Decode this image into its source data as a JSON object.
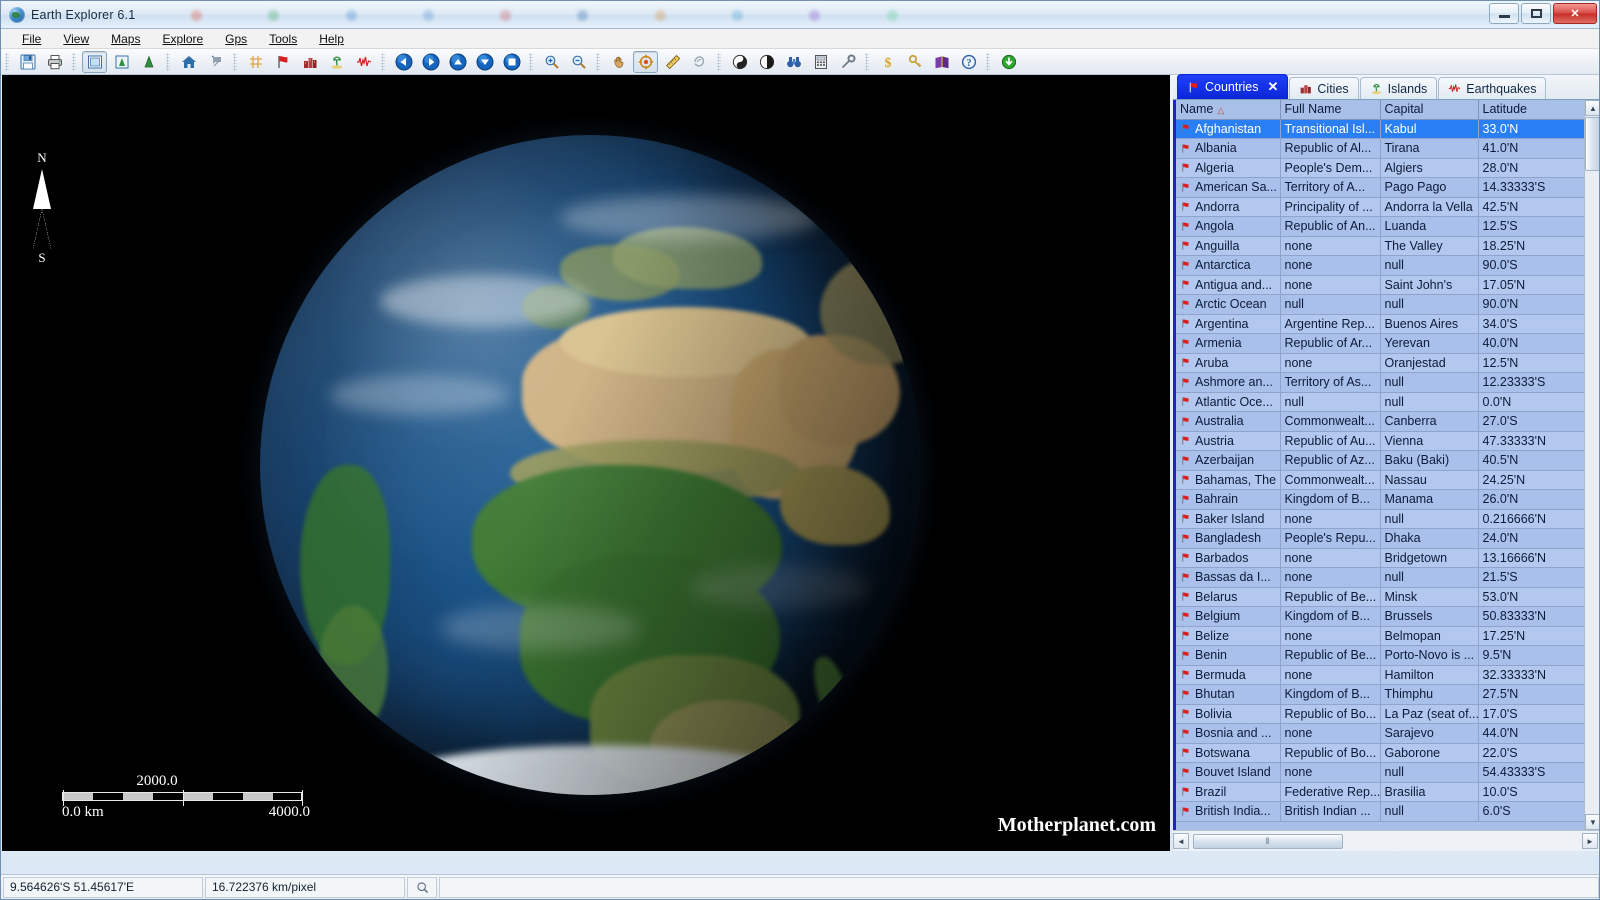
{
  "window": {
    "title": "Earth Explorer 6.1",
    "app_icon": "globe-icon",
    "minimize_label": "–",
    "maximize_label": "❑",
    "close_label": "✕"
  },
  "menu": {
    "items": [
      {
        "label": "File",
        "mnemonic": "F"
      },
      {
        "label": "View",
        "mnemonic": "V"
      },
      {
        "label": "Maps",
        "mnemonic": "M"
      },
      {
        "label": "Explore",
        "mnemonic": "E"
      },
      {
        "label": "Gps",
        "mnemonic": "G"
      },
      {
        "label": "Tools",
        "mnemonic": "T"
      },
      {
        "label": "Help",
        "mnemonic": "H"
      }
    ]
  },
  "toolbar": {
    "groups": [
      {
        "buttons": [
          {
            "name": "save-button",
            "icon": "floppy-disk-icon",
            "pressed": false
          },
          {
            "name": "print-button",
            "icon": "printer-icon",
            "pressed": false
          }
        ]
      },
      {
        "buttons": [
          {
            "name": "flat-map-button",
            "icon": "square-map-icon",
            "pressed": true
          },
          {
            "name": "globe-small-button",
            "icon": "globe-box-icon",
            "pressed": false
          },
          {
            "name": "globe-button",
            "icon": "globe-cone-icon",
            "pressed": false
          }
        ]
      },
      {
        "buttons": [
          {
            "name": "home-button",
            "icon": "home-icon",
            "pressed": false
          },
          {
            "name": "add-location-button",
            "icon": "add-pin-icon",
            "pressed": false
          }
        ]
      },
      {
        "buttons": [
          {
            "name": "grid-button",
            "icon": "grid-icon",
            "pressed": false
          },
          {
            "name": "countries-button",
            "icon": "red-flag-icon",
            "pressed": false
          },
          {
            "name": "cities-button",
            "icon": "city-icon",
            "pressed": false
          },
          {
            "name": "islands-button",
            "icon": "island-icon",
            "pressed": false
          },
          {
            "name": "earthquakes-button",
            "icon": "seismograph-icon",
            "pressed": false
          }
        ]
      },
      {
        "buttons": [
          {
            "name": "pan-left-button",
            "icon": "arrow-left-icon",
            "pressed": false
          },
          {
            "name": "pan-right-button",
            "icon": "arrow-right-icon",
            "pressed": false
          },
          {
            "name": "pan-up-button",
            "icon": "arrow-up-icon",
            "pressed": false
          },
          {
            "name": "pan-down-button",
            "icon": "arrow-down-icon",
            "pressed": false
          },
          {
            "name": "stop-button",
            "icon": "stop-square-icon",
            "pressed": false
          }
        ]
      },
      {
        "buttons": [
          {
            "name": "zoom-in-button",
            "icon": "magnifier-plus-icon",
            "pressed": false
          },
          {
            "name": "zoom-out-button",
            "icon": "magnifier-minus-icon",
            "pressed": false
          }
        ]
      },
      {
        "buttons": [
          {
            "name": "hand-tool-button",
            "icon": "hand-icon",
            "pressed": false
          },
          {
            "name": "target-tool-button",
            "icon": "crosshair-target-icon",
            "pressed": true
          },
          {
            "name": "measure-tool-button",
            "icon": "ruler-icon",
            "pressed": false
          },
          {
            "name": "area-tool-button",
            "icon": "polygon-icon",
            "pressed": false
          }
        ]
      },
      {
        "buttons": [
          {
            "name": "day-night-button",
            "icon": "yin-yang-icon",
            "pressed": false
          },
          {
            "name": "terminator-button",
            "icon": "half-moon-icon",
            "pressed": false
          },
          {
            "name": "find-button",
            "icon": "binoculars-icon",
            "pressed": false
          },
          {
            "name": "calculator-button",
            "icon": "calculator-icon",
            "pressed": false
          },
          {
            "name": "options-button",
            "icon": "tools-icon",
            "pressed": false
          }
        ]
      },
      {
        "buttons": [
          {
            "name": "currency-button",
            "icon": "dollar-icon",
            "pressed": false
          },
          {
            "name": "keys-button",
            "icon": "key-icon",
            "pressed": false
          },
          {
            "name": "atlas-book-button",
            "icon": "book-icon",
            "pressed": false
          },
          {
            "name": "help-button",
            "icon": "question-mark-icon",
            "pressed": false
          }
        ]
      },
      {
        "buttons": [
          {
            "name": "download-button",
            "icon": "green-download-icon",
            "pressed": false
          }
        ]
      }
    ]
  },
  "viewport": {
    "compass": {
      "north_label": "N",
      "south_label": "S"
    },
    "scalebar": {
      "mid_label": "2000.0",
      "start_label": "0.0 km",
      "end_label": "4000.0"
    },
    "watermark": "Motherplanet.com"
  },
  "panel": {
    "tabs": [
      {
        "label": "Countries",
        "icon": "red-flag-icon",
        "active": true,
        "closable": true,
        "close_label": "✕"
      },
      {
        "label": "Cities",
        "icon": "city-icon",
        "active": false,
        "closable": false
      },
      {
        "label": "Islands",
        "icon": "island-icon",
        "active": false,
        "closable": false
      },
      {
        "label": "Earthquakes",
        "icon": "seismograph-icon",
        "active": false,
        "closable": false
      }
    ],
    "columns": [
      {
        "label": "Name",
        "sorted": true,
        "sort_mark": "△"
      },
      {
        "label": "Full Name",
        "sorted": false
      },
      {
        "label": "Capital",
        "sorted": false
      },
      {
        "label": "Latitude",
        "sorted": false
      }
    ],
    "rows": [
      {
        "name": "Afghanistan",
        "full": "Transitional Isl...",
        "capital": "Kabul",
        "lat": "33.0'N",
        "selected": true
      },
      {
        "name": "Albania",
        "full": "Republic of Al...",
        "capital": "Tirana",
        "lat": "41.0'N",
        "selected": false
      },
      {
        "name": "Algeria",
        "full": "People's Dem...",
        "capital": "Algiers",
        "lat": "28.0'N",
        "selected": false
      },
      {
        "name": "American Sa...",
        "full": "Territory of A...",
        "capital": "Pago Pago",
        "lat": "14.33333'S",
        "selected": false
      },
      {
        "name": "Andorra",
        "full": "Principality of ...",
        "capital": "Andorra la Vella",
        "lat": "42.5'N",
        "selected": false
      },
      {
        "name": "Angola",
        "full": "Republic of An...",
        "capital": "Luanda",
        "lat": "12.5'S",
        "selected": false
      },
      {
        "name": "Anguilla",
        "full": "none",
        "capital": "The Valley",
        "lat": "18.25'N",
        "selected": false
      },
      {
        "name": "Antarctica",
        "full": "none",
        "capital": "null",
        "lat": "90.0'S",
        "selected": false
      },
      {
        "name": "Antigua and...",
        "full": "none",
        "capital": "Saint John's",
        "lat": "17.05'N",
        "selected": false
      },
      {
        "name": "Arctic Ocean",
        "full": "null",
        "capital": "null",
        "lat": "90.0'N",
        "selected": false
      },
      {
        "name": "Argentina",
        "full": "Argentine Rep...",
        "capital": "Buenos Aires",
        "lat": "34.0'S",
        "selected": false
      },
      {
        "name": "Armenia",
        "full": "Republic of Ar...",
        "capital": "Yerevan",
        "lat": "40.0'N",
        "selected": false
      },
      {
        "name": "Aruba",
        "full": "none",
        "capital": "Oranjestad",
        "lat": "12.5'N",
        "selected": false
      },
      {
        "name": "Ashmore an...",
        "full": "Territory of As...",
        "capital": "null",
        "lat": "12.23333'S",
        "selected": false
      },
      {
        "name": "Atlantic Oce...",
        "full": "null",
        "capital": "null",
        "lat": "0.0'N",
        "selected": false
      },
      {
        "name": "Australia",
        "full": "Commonwealt...",
        "capital": "Canberra",
        "lat": "27.0'S",
        "selected": false
      },
      {
        "name": "Austria",
        "full": "Republic of Au...",
        "capital": "Vienna",
        "lat": "47.33333'N",
        "selected": false
      },
      {
        "name": "Azerbaijan",
        "full": "Republic of Az...",
        "capital": "Baku (Baki)",
        "lat": "40.5'N",
        "selected": false
      },
      {
        "name": "Bahamas, The",
        "full": "Commonwealt...",
        "capital": "Nassau",
        "lat": "24.25'N",
        "selected": false
      },
      {
        "name": "Bahrain",
        "full": "Kingdom of B...",
        "capital": "Manama",
        "lat": "26.0'N",
        "selected": false
      },
      {
        "name": "Baker Island",
        "full": "none",
        "capital": "null",
        "lat": "0.216666'N",
        "selected": false
      },
      {
        "name": "Bangladesh",
        "full": "People's Repu...",
        "capital": "Dhaka",
        "lat": "24.0'N",
        "selected": false
      },
      {
        "name": "Barbados",
        "full": "none",
        "capital": "Bridgetown",
        "lat": "13.16666'N",
        "selected": false
      },
      {
        "name": "Bassas da I...",
        "full": "none",
        "capital": "null",
        "lat": "21.5'S",
        "selected": false
      },
      {
        "name": "Belarus",
        "full": "Republic of Be...",
        "capital": "Minsk",
        "lat": "53.0'N",
        "selected": false
      },
      {
        "name": "Belgium",
        "full": "Kingdom of B...",
        "capital": "Brussels",
        "lat": "50.83333'N",
        "selected": false
      },
      {
        "name": "Belize",
        "full": "none",
        "capital": "Belmopan",
        "lat": "17.25'N",
        "selected": false
      },
      {
        "name": "Benin",
        "full": "Republic of Be...",
        "capital": "Porto-Novo is ...",
        "lat": "9.5'N",
        "selected": false
      },
      {
        "name": "Bermuda",
        "full": "none",
        "capital": "Hamilton",
        "lat": "32.33333'N",
        "selected": false
      },
      {
        "name": "Bhutan",
        "full": "Kingdom of B...",
        "capital": "Thimphu",
        "lat": "27.5'N",
        "selected": false
      },
      {
        "name": "Bolivia",
        "full": "Republic of Bo...",
        "capital": "La Paz (seat of...",
        "lat": "17.0'S",
        "selected": false
      },
      {
        "name": "Bosnia and ...",
        "full": "none",
        "capital": "Sarajevo",
        "lat": "44.0'N",
        "selected": false
      },
      {
        "name": "Botswana",
        "full": "Republic of Bo...",
        "capital": "Gaborone",
        "lat": "22.0'S",
        "selected": false
      },
      {
        "name": "Bouvet Island",
        "full": "none",
        "capital": "null",
        "lat": "54.43333'S",
        "selected": false
      },
      {
        "name": "Brazil",
        "full": "Federative Rep...",
        "capital": "Brasilia",
        "lat": "10.0'S",
        "selected": false
      },
      {
        "name": "British India...",
        "full": "British Indian ...",
        "capital": "null",
        "lat": "6.0'S",
        "selected": false
      }
    ],
    "scrollbar": {
      "up_arrow": "▲",
      "down_arrow": "▼",
      "left_arrow": "◄",
      "right_arrow": "►",
      "thumb_grip": "‖"
    }
  },
  "statusbar": {
    "coordinates": "9.564626'S  51.45617'E",
    "scale": "16.722376 km/pixel",
    "magnifier_icon": "magnifier-icon"
  },
  "colors": {
    "accent": "#2b7ff5",
    "tab_active": "#0b26d8",
    "grid_row_a": "#b3c8ee",
    "grid_row_b": "#a9c0ea",
    "flag_red": "#d91f1f",
    "close_red": "#c62f28"
  }
}
